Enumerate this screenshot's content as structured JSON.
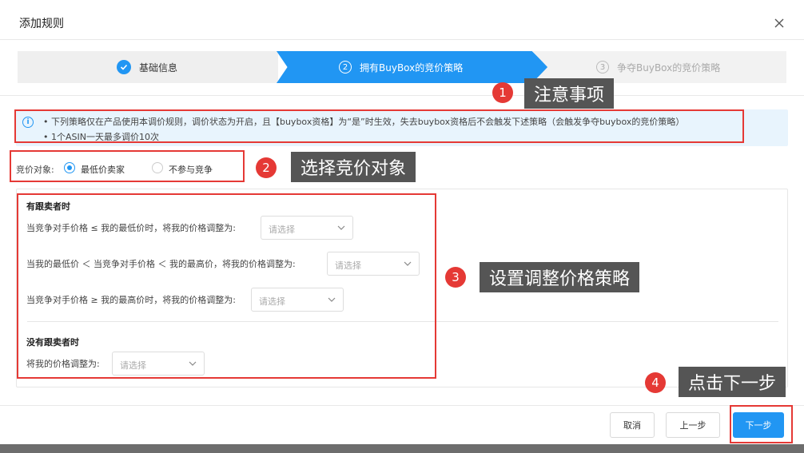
{
  "dialog": {
    "title": "添加规则"
  },
  "steps": [
    {
      "label": "基础信息",
      "state": "done"
    },
    {
      "number": "2",
      "label": "拥有BuyBox的竞价策略",
      "state": "active"
    },
    {
      "number": "3",
      "label": "争夺BuyBox的竞价策略",
      "state": "pending"
    }
  ],
  "notice": {
    "lines": [
      "• 下列策略仅在产品使用本调价规则，调价状态为开启，且【buybox资格】为“是”时生效，失去buybox资格后不会触发下述策略（会触发争夺buybox的竞价策略）",
      "• 1个ASIN一天最多调价10次"
    ]
  },
  "competitor": {
    "label": "竞价对象:",
    "options": [
      "最低价卖家",
      "不参与竞争"
    ],
    "selected": "最低价卖家"
  },
  "strategy": {
    "with_sellers_title": "有跟卖者时",
    "rules": [
      "当竞争对手价格 ≤ 我的最低价时，将我的价格调整为:",
      "当我的最低价 ＜ 当竞争对手价格 ＜ 我的最高价，将我的价格调整为:",
      "当竞争对手价格 ≥ 我的最高价时，将我的价格调整为:"
    ],
    "without_sellers_title": "没有跟卖者时",
    "without_rule": "将我的价格调整为:",
    "select_placeholder": "请选择"
  },
  "footer": {
    "cancel": "取消",
    "prev": "上一步",
    "next": "下一步"
  },
  "annotations": [
    {
      "number": "1",
      "text": "注意事项"
    },
    {
      "number": "2",
      "text": "选择竞价对象"
    },
    {
      "number": "3",
      "text": "设置调整价格策略"
    },
    {
      "number": "4",
      "text": "点击下一步"
    }
  ],
  "colors": {
    "primary": "#2196f3",
    "annotation_red": "#e53935",
    "callout_bg": "#555555",
    "notice_bg": "#e8f4fd"
  }
}
